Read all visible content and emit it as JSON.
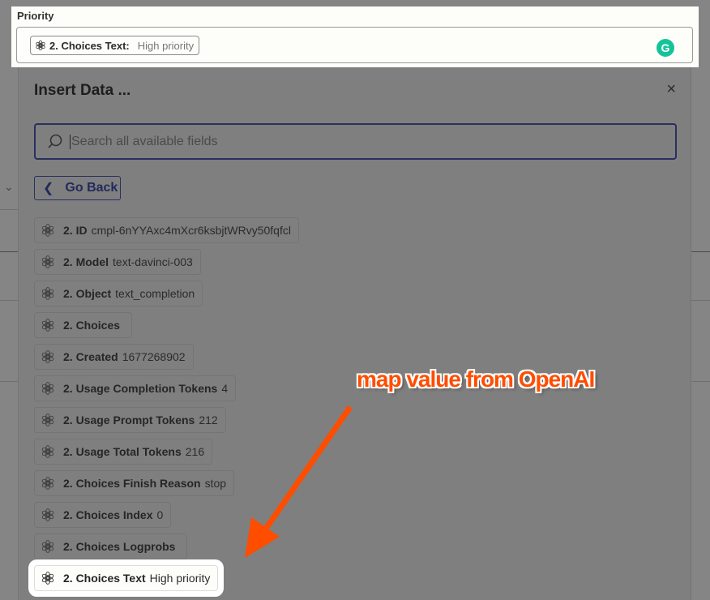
{
  "priority": {
    "label": "Priority",
    "pill_label": "2. Choices Text:",
    "pill_value": "High priority",
    "grammarly_icon": "G"
  },
  "modal": {
    "title": "Insert Data ...",
    "close": "×",
    "search_placeholder": "Search all available fields",
    "go_back": "Go Back",
    "items": [
      {
        "label": "2. ID",
        "value": "cmpl-6nYYAxc4mXcr6ksbjtWRvy50fqfcl"
      },
      {
        "label": "2. Model",
        "value": "text-davinci-003"
      },
      {
        "label": "2. Object",
        "value": "text_completion"
      },
      {
        "label": "2. Choices",
        "value": ""
      },
      {
        "label": "2. Created",
        "value": "1677268902"
      },
      {
        "label": "2. Usage Completion Tokens",
        "value": "4"
      },
      {
        "label": "2. Usage Prompt Tokens",
        "value": "212"
      },
      {
        "label": "2. Usage Total Tokens",
        "value": "216"
      },
      {
        "label": "2. Choices Finish Reason",
        "value": "stop"
      },
      {
        "label": "2. Choices Index",
        "value": "0"
      },
      {
        "label": "2. Choices Logprobs",
        "value": ""
      },
      {
        "label": "2. Choices Text",
        "value": "High priority"
      }
    ]
  },
  "annotation": {
    "text": "map value from OpenAI",
    "color": "#ff4d00"
  }
}
